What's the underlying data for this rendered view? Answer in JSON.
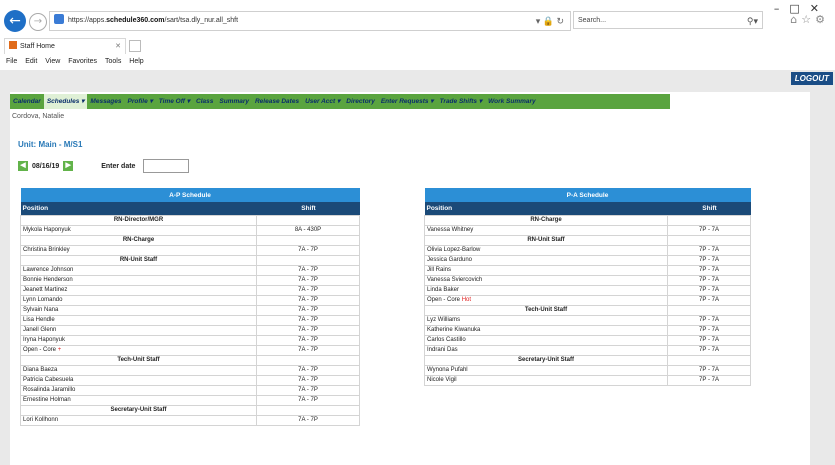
{
  "browser": {
    "url_prefix": "https://apps.",
    "url_host": "schedule360.com",
    "url_path": "/sart/tsa.dly_nur.all_shft",
    "search_placeholder": "Search...",
    "tab_title": "Staff Home",
    "menu": [
      "File",
      "Edit",
      "View",
      "Favorites",
      "Tools",
      "Help"
    ]
  },
  "header": {
    "logout": "LOGOUT"
  },
  "nav": {
    "items": [
      "Calendar",
      "Schedules ▾",
      "Messages",
      "Profile ▾",
      "Time Off ▾",
      "Class",
      "Summary",
      "Release Dates",
      "User Acct ▾",
      "Directory",
      "Enter Requests ▾",
      "Trade Shifts ▾",
      "Work Summary"
    ],
    "active_index": 1
  },
  "user": {
    "name": "Cordova, Natalie"
  },
  "unit": {
    "title": "Unit: Main - M/S1"
  },
  "date": {
    "current": "08/16/19",
    "enter_label": "Enter date"
  },
  "ap_schedule": {
    "caption": "A-P Schedule",
    "col_position": "Position",
    "col_shift": "Shift",
    "rows": [
      {
        "type": "group",
        "name": "RN-Director/MGR"
      },
      {
        "name": "Mykola Haponyuk",
        "shift": "8A - 430P"
      },
      {
        "type": "group",
        "name": "RN-Charge"
      },
      {
        "name": "Christina Brinkley",
        "shift": "7A - 7P"
      },
      {
        "type": "group",
        "name": "RN-Unit Staff"
      },
      {
        "name": "Lawrence Johnson",
        "shift": "7A - 7P"
      },
      {
        "name": "Bonnie Henderson",
        "shift": "7A - 7P"
      },
      {
        "name": "Jeanett Martinez",
        "shift": "7A - 7P"
      },
      {
        "name": "Lynn Lomando",
        "shift": "7A - 7P"
      },
      {
        "name": "Sylvain Nana",
        "shift": "7A - 7P"
      },
      {
        "name": "Lisa Hendle",
        "shift": "7A - 7P"
      },
      {
        "name": "Janell Glenn",
        "shift": "7A - 7P"
      },
      {
        "name": "Iryna Haponyuk",
        "shift": "7A - 7P"
      },
      {
        "name": "Open - Core",
        "tag": "+",
        "shift": "7A - 7P"
      },
      {
        "type": "group",
        "name": "Tech-Unit Staff"
      },
      {
        "name": "Diana Baeza",
        "shift": "7A - 7P"
      },
      {
        "name": "Patricia Cabesuela",
        "shift": "7A - 7P"
      },
      {
        "name": "Rosalinda Jaramillo",
        "shift": "7A - 7P"
      },
      {
        "name": "Ernestine Holman",
        "shift": "7A - 7P"
      },
      {
        "type": "group",
        "name": "Secretary-Unit Staff"
      },
      {
        "name": "Lori Kollhonn",
        "shift": "7A - 7P"
      }
    ]
  },
  "pa_schedule": {
    "caption": "P-A Schedule",
    "col_position": "Position",
    "col_shift": "Shift",
    "rows": [
      {
        "type": "group",
        "name": "RN-Charge"
      },
      {
        "name": "Vanessa Whitney",
        "shift": "7P - 7A"
      },
      {
        "type": "group",
        "name": "RN-Unit Staff"
      },
      {
        "name": "Olivia Lopez-Barlow",
        "shift": "7P - 7A"
      },
      {
        "name": "Jessica Garduno",
        "shift": "7P - 7A"
      },
      {
        "name": "Jill Rains",
        "shift": "7P - 7A"
      },
      {
        "name": "Vanessa Sviercovich",
        "shift": "7P - 7A"
      },
      {
        "name": "Linda Baker",
        "shift": "7P - 7A"
      },
      {
        "name": "Open - Core",
        "tag": "Hot",
        "shift": "7P - 7A"
      },
      {
        "type": "group",
        "name": "Tech-Unit Staff"
      },
      {
        "name": "Lyz Williams",
        "shift": "7P - 7A"
      },
      {
        "name": "Katherine Kiwanuka",
        "shift": "7P - 7A"
      },
      {
        "name": "Carlos Castillo",
        "shift": "7P - 7A"
      },
      {
        "name": "Indrani Das",
        "shift": "7P - 7A"
      },
      {
        "type": "group",
        "name": "Secretary-Unit Staff"
      },
      {
        "name": "Wynona Pufahl",
        "shift": "7P - 7A"
      },
      {
        "name": "Nicole Vigil",
        "shift": "7P - 7A"
      }
    ]
  }
}
